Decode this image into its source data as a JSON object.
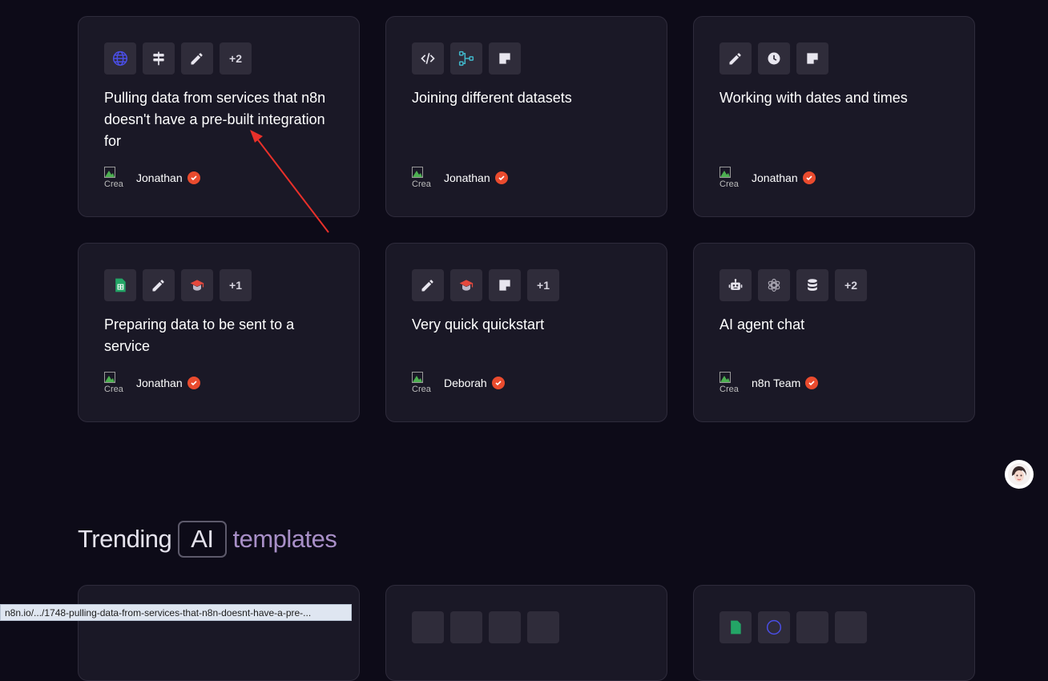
{
  "cards": [
    {
      "title": "Pulling data from services that n8n doesn't have a pre-built integration for",
      "author": "Jonathan",
      "icons": [
        "globe-icon",
        "signpost-icon",
        "pencil-icon"
      ],
      "more": "+2"
    },
    {
      "title": "Joining different datasets",
      "author": "Jonathan",
      "icons": [
        "code-icon",
        "merge-icon",
        "sticky-note-icon"
      ],
      "more": ""
    },
    {
      "title": "Working with dates and times",
      "author": "Jonathan",
      "icons": [
        "pencil-icon",
        "clock-icon",
        "sticky-note-icon"
      ],
      "more": ""
    },
    {
      "title": "Preparing data to be sent to a service",
      "author": "Jonathan",
      "icons": [
        "google-sheets-icon",
        "pencil-icon",
        "graduation-cap-icon"
      ],
      "more": "+1"
    },
    {
      "title": "Very quick quickstart",
      "author": "Deborah",
      "icons": [
        "pencil-icon",
        "graduation-cap-icon",
        "sticky-note-icon"
      ],
      "more": "+1"
    },
    {
      "title": "AI agent chat",
      "author": "n8n Team",
      "icons": [
        "robot-icon",
        "openai-icon",
        "database-icon"
      ],
      "more": "+2"
    }
  ],
  "avatar_alt": "Crea",
  "section": {
    "word1": "Trending",
    "badge": "AI",
    "word2": "templates"
  },
  "status_url": "n8n.io/.../1748-pulling-data-from-services-that-n8n-doesnt-have-a-pre-...",
  "colors": {
    "background": "#0d0b18",
    "card": "#1a1826",
    "verified": "#ea4b2e",
    "accent_purple": "#a88fc7",
    "annotation_arrow": "#e8302a"
  }
}
